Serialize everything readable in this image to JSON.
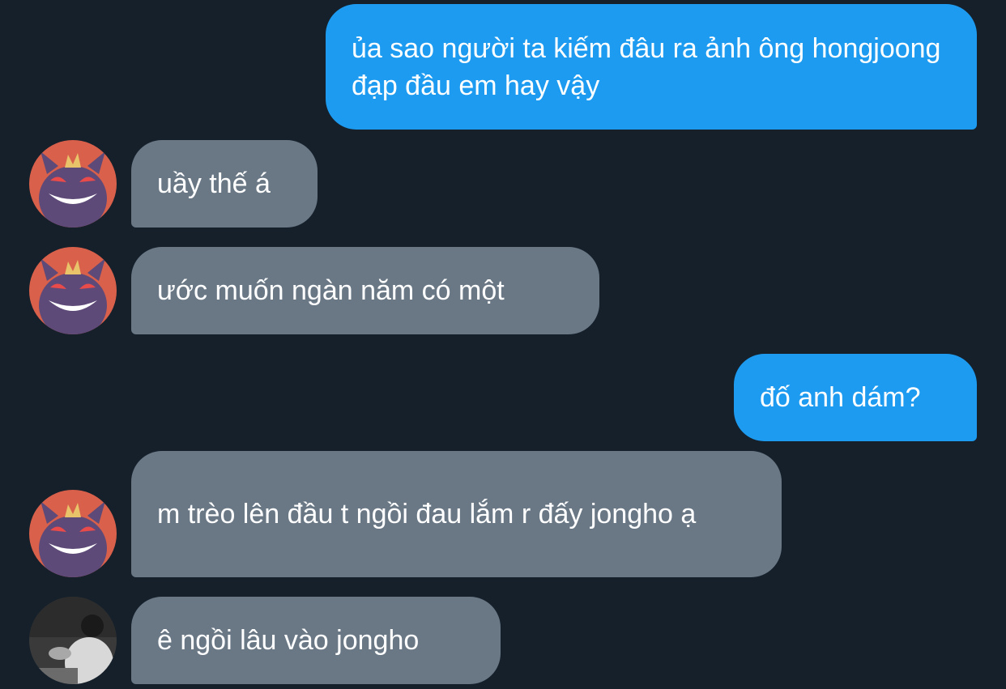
{
  "conversation": {
    "messages": [
      {
        "sender": "me",
        "text": "ủa sao người ta kiếm đâu ra ảnh ông hongjoong đạp đầu em hay vậy"
      },
      {
        "sender": "other",
        "avatar": "gengar-avatar",
        "text": "uầy thế á"
      },
      {
        "sender": "other",
        "avatar": "gengar-avatar",
        "text": "ước muốn ngàn năm có một"
      },
      {
        "sender": "me",
        "text": "đố anh dám?"
      },
      {
        "sender": "other",
        "avatar": "gengar-avatar",
        "text": "m trèo lên đầu t ngồi đau lắm r đấy jongho ạ"
      },
      {
        "sender": "other-2",
        "avatar": "person-photo-avatar",
        "text": "ê ngồi lâu vào jongho"
      }
    ]
  },
  "colors": {
    "background": "#15202b",
    "sent_bubble": "#1d9bf0",
    "received_bubble": "#6a7886",
    "text": "#ffffff"
  }
}
